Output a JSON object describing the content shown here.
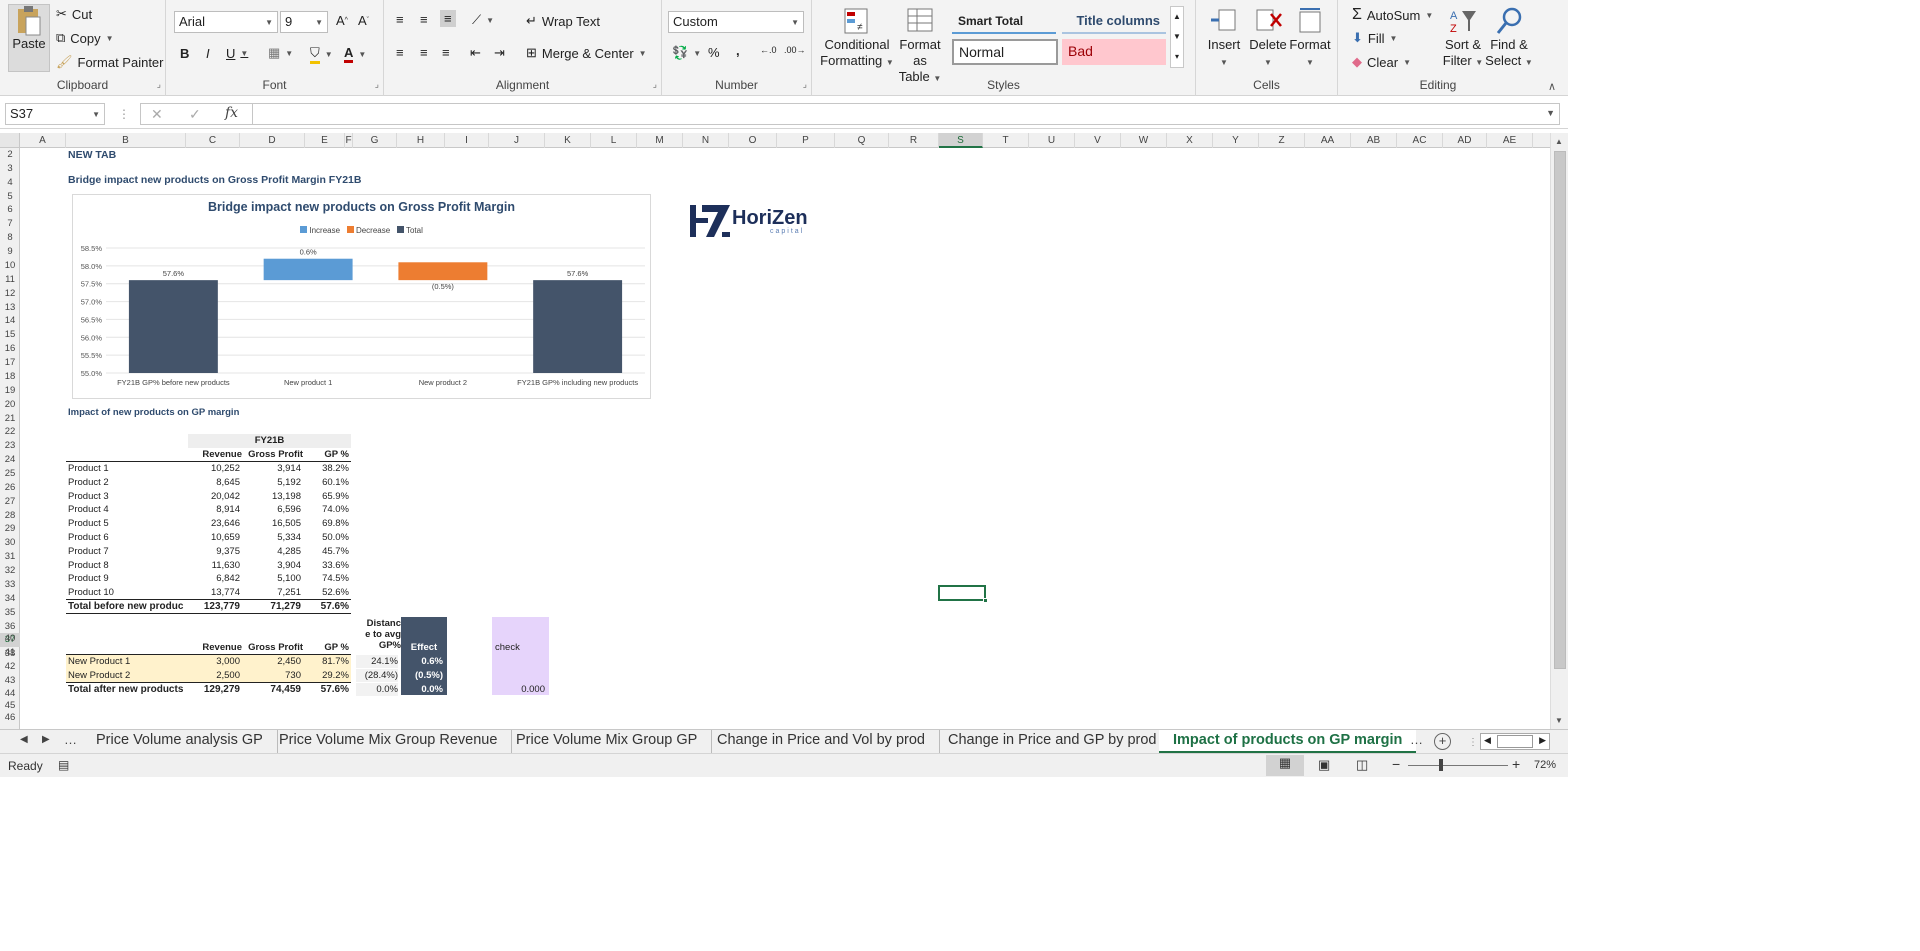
{
  "ribbon": {
    "clipboard": {
      "label": "Clipboard",
      "paste": "Paste",
      "cut": "Cut",
      "copy": "Copy",
      "format_painter": "Format Painter"
    },
    "font": {
      "label": "Font",
      "name": "Arial",
      "size": "9",
      "bold": "B",
      "italic": "I",
      "underline": "U"
    },
    "alignment": {
      "label": "Alignment",
      "wrap_text": "Wrap Text",
      "merge_center": "Merge & Center"
    },
    "number": {
      "label": "Number",
      "format": "Custom",
      "percent": "%",
      "comma": ","
    },
    "styles": {
      "label": "Styles",
      "conditional": "Conditional",
      "conditional2": "Formatting",
      "format_as": "Format as",
      "format_as2": "Table",
      "smart_total": "Smart Total",
      "title_columns": "Title columns",
      "normal": "Normal",
      "bad": "Bad"
    },
    "cells": {
      "label": "Cells",
      "insert": "Insert",
      "delete": "Delete",
      "format": "Format"
    },
    "editing": {
      "label": "Editing",
      "autosum": "AutoSum",
      "fill": "Fill",
      "clear": "Clear",
      "sort": "Sort &",
      "sort2": "Filter",
      "find": "Find &",
      "find2": "Select"
    }
  },
  "formula_bar": {
    "name_box": "S37",
    "fx": "fx",
    "cancel": "✕",
    "enter": "✓",
    "content": ""
  },
  "columns": [
    "A",
    "B",
    "C",
    "D",
    "E",
    "F",
    "G",
    "H",
    "I",
    "J",
    "K",
    "L",
    "M",
    "N",
    "O",
    "P",
    "Q",
    "R",
    "S",
    "T",
    "U",
    "V",
    "W",
    "X",
    "Y",
    "Z",
    "AA",
    "AB",
    "AC",
    "AD",
    "AE"
  ],
  "rows": [
    "2",
    "3",
    "4",
    "5",
    "6",
    "7",
    "8",
    "9",
    "10",
    "11",
    "12",
    "13",
    "14",
    "15",
    "16",
    "17",
    "18",
    "19",
    "20",
    "21",
    "22",
    "23",
    "24",
    "25",
    "26",
    "27",
    "28",
    "29",
    "30",
    "31",
    "32",
    "33",
    "34",
    "35",
    "36",
    "37",
    "38",
    "39",
    "40",
    "41",
    "42",
    "43",
    "44",
    "45",
    "46"
  ],
  "sheet": {
    "new_tab": "NEW TAB",
    "section_title": "Bridge impact new products on Gross Profit Margin FY21B",
    "impact_title": "Impact of new products on GP margin",
    "fy": "FY21B",
    "headers": {
      "revenue": "Revenue",
      "gross_profit": "Gross Profit",
      "gp": "GP %",
      "distance": "Distanc",
      "distance2": "e to avg",
      "distance3": "GP%",
      "effect": "Effect",
      "check": "check"
    },
    "products": [
      {
        "name": "Product 1",
        "revenue": "10,252",
        "gp": "3,914",
        "pct": "38.2%"
      },
      {
        "name": "Product 2",
        "revenue": "8,645",
        "gp": "5,192",
        "pct": "60.1%"
      },
      {
        "name": "Product 3",
        "revenue": "20,042",
        "gp": "13,198",
        "pct": "65.9%"
      },
      {
        "name": "Product 4",
        "revenue": "8,914",
        "gp": "6,596",
        "pct": "74.0%"
      },
      {
        "name": "Product 5",
        "revenue": "23,646",
        "gp": "16,505",
        "pct": "69.8%"
      },
      {
        "name": "Product 6",
        "revenue": "10,659",
        "gp": "5,334",
        "pct": "50.0%"
      },
      {
        "name": "Product 7",
        "revenue": "9,375",
        "gp": "4,285",
        "pct": "45.7%"
      },
      {
        "name": "Product 8",
        "revenue": "11,630",
        "gp": "3,904",
        "pct": "33.6%"
      },
      {
        "name": "Product 9",
        "revenue": "6,842",
        "gp": "5,100",
        "pct": "74.5%"
      },
      {
        "name": "Product 10",
        "revenue": "13,774",
        "gp": "7,251",
        "pct": "52.6%"
      }
    ],
    "total_before": {
      "name": "Total before new produc",
      "revenue": "123,779",
      "gp": "71,279",
      "pct": "57.6%"
    },
    "new_products": [
      {
        "name": "New Product 1",
        "revenue": "3,000",
        "gp": "2,450",
        "pct": "81.7%",
        "distance": "24.1%",
        "effect": "0.6%"
      },
      {
        "name": "New Product 2",
        "revenue": "2,500",
        "gp": "730",
        "pct": "29.2%",
        "distance": "(28.4%)",
        "effect": "(0.5%)"
      }
    ],
    "total_after": {
      "name": "Total after new products",
      "revenue": "129,279",
      "gp": "74,459",
      "pct": "57.6%",
      "distance": "0.0%",
      "effect": "0.0%",
      "check": "0.000"
    }
  },
  "logo": {
    "text": "HoriZen",
    "sub": "capital"
  },
  "chart_data": {
    "type": "bar",
    "title": "Bridge impact new products on Gross Profit Margin",
    "legend": [
      "Increase",
      "Decrease",
      "Total"
    ],
    "legend_position": "top",
    "categories": [
      "FY21B GP% before new products",
      "New product 1",
      "New product 2",
      "FY21B GP% including new products"
    ],
    "bars": [
      {
        "kind": "total",
        "base": 55.0,
        "top": 57.6,
        "label": "57.6%"
      },
      {
        "kind": "increase",
        "base": 57.6,
        "top": 58.2,
        "label": "0.6%"
      },
      {
        "kind": "decrease",
        "base": 57.6,
        "top": 58.1,
        "label": "(0.5%)"
      },
      {
        "kind": "total",
        "base": 55.0,
        "top": 57.6,
        "label": "57.6%"
      }
    ],
    "yticks": [
      "58.5%",
      "58.0%",
      "57.5%",
      "57.0%",
      "56.5%",
      "56.0%",
      "55.5%",
      "55.0%"
    ],
    "ylim": [
      55.0,
      58.5
    ],
    "colors": {
      "increase": "#5b9bd5",
      "decrease": "#ed7d31",
      "total": "#44546a"
    }
  },
  "tabs": [
    "Price Volume analysis GP",
    "Price Volume Mix Group Revenue",
    "Price Volume Mix Group GP",
    "Change in Price and Vol by prod",
    "Change in Price and GP by prod",
    "Impact of products on GP margin"
  ],
  "status": {
    "ready": "Ready",
    "zoom": "72%"
  }
}
